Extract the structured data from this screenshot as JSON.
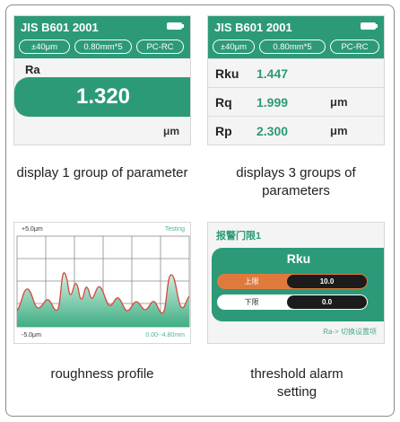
{
  "colors": {
    "accent": "#2c9a78",
    "upper_limit": "#e07a3c",
    "curve": "#d44a3c",
    "fill": "#8fd3b5"
  },
  "screen1": {
    "header": "JIS B601 2001",
    "chips": [
      "±40μm",
      "0.80mm*5",
      "PC-RC"
    ],
    "param": "Ra",
    "value": "1.320",
    "unit": "μm",
    "caption": "display 1 group of parameter"
  },
  "screen2": {
    "header": "JIS B601 2001",
    "chips": [
      "±40μm",
      "0.80mm*5",
      "PC-RC"
    ],
    "rows": [
      {
        "name": "Rku",
        "value": "1.447",
        "unit": ""
      },
      {
        "name": "Rq",
        "value": "1.999",
        "unit": "μm"
      },
      {
        "name": "Rp",
        "value": "2.300",
        "unit": "μm"
      }
    ],
    "caption": "displays 3 groups of parameters"
  },
  "screen3": {
    "top_left": "+5.0μm",
    "top_right": "Testing",
    "bottom_left": "-5.0μm",
    "bottom_right": "0.00--4.80mm",
    "caption": "roughness profile"
  },
  "screen4": {
    "title": "报警门限1",
    "param": "Rku",
    "upper_label": "上限",
    "upper_value": "10.0",
    "lower_label": "下限",
    "lower_value": "0.0",
    "hint": "Ra-> 切换设置项",
    "caption": "threshold alarm setting"
  }
}
